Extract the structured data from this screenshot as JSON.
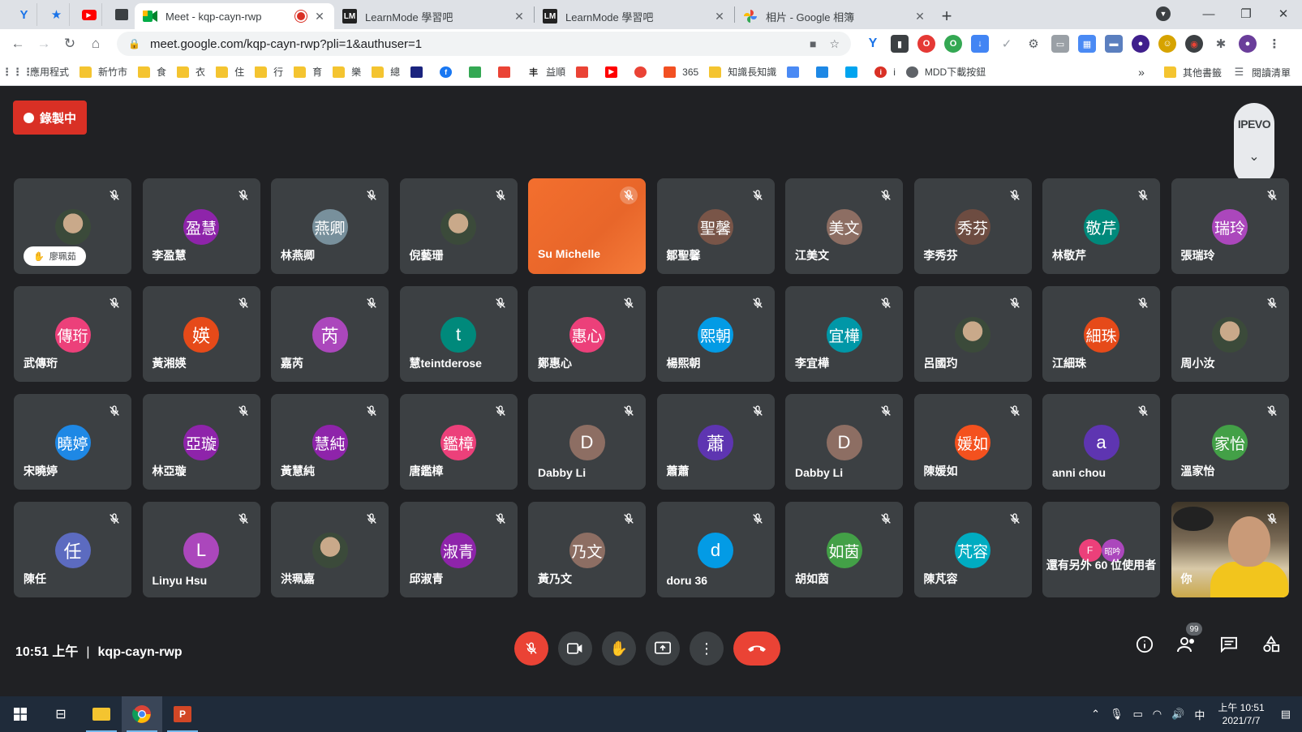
{
  "browser": {
    "tabs": [
      {
        "title": "Meet - kqp-cayn-rwp",
        "favicon": "meet-icon",
        "active": true,
        "recording": true
      },
      {
        "title": "LearnMode 學習吧",
        "favicon": "learnmode-icon",
        "active": false
      },
      {
        "title": "LearnMode 學習吧",
        "favicon": "learnmode-icon",
        "active": false
      },
      {
        "title": "相片 - Google 相簿",
        "favicon": "google-photos-icon",
        "active": false
      }
    ],
    "url": "meet.google.com/kqp-cayn-rwp?pli=1&authuser=1",
    "bookmarks": [
      {
        "label": "應用程式",
        "icon": "apps-grid-icon"
      },
      {
        "label": "新竹市",
        "icon": "folder-icon"
      },
      {
        "label": "食",
        "icon": "folder-icon"
      },
      {
        "label": "衣",
        "icon": "folder-icon"
      },
      {
        "label": "住",
        "icon": "folder-icon"
      },
      {
        "label": "行",
        "icon": "folder-icon"
      },
      {
        "label": "育",
        "icon": "folder-icon"
      },
      {
        "label": "樂",
        "icon": "folder-icon"
      },
      {
        "label": "總",
        "icon": "folder-icon"
      },
      {
        "label": "",
        "icon": "qr-icon"
      },
      {
        "label": "",
        "icon": "facebook-icon"
      },
      {
        "label": "",
        "icon": "google-drive-icon"
      },
      {
        "label": "",
        "icon": "pinwheel-icon"
      },
      {
        "label": "益順",
        "icon": "yi-icon"
      },
      {
        "label": "",
        "icon": "gmail-icon"
      },
      {
        "label": "",
        "icon": "youtube-icon"
      },
      {
        "label": "",
        "icon": "refresh-red-icon"
      },
      {
        "label": "365",
        "icon": "office-icon"
      },
      {
        "label": "知識長知識",
        "icon": "folder-icon"
      },
      {
        "label": "",
        "icon": "translate-icon"
      },
      {
        "label": "",
        "icon": "blue-app-icon"
      },
      {
        "label": "",
        "icon": "windows-icon"
      },
      {
        "label": "i",
        "icon": "info-red-icon"
      },
      {
        "label": "MDD下載按鈕",
        "icon": "globe-icon"
      }
    ],
    "bookmarks_more": "»",
    "other_bookmarks": "其他書籤",
    "reading_list": "閱讀清單"
  },
  "meet": {
    "recording_label": "錄製中",
    "ipevo_label": "IPEVO",
    "participants": [
      {
        "name": "廖珮茹",
        "initials": "",
        "color": "",
        "photo": true,
        "hand_pill": true
      },
      {
        "name": "李盈慧",
        "initials": "盈慧",
        "color": "#8e24aa"
      },
      {
        "name": "林燕卿",
        "initials": "燕卿",
        "color": "#78909c"
      },
      {
        "name": "倪藝珊",
        "initials": "",
        "color": "",
        "photo": true
      },
      {
        "name": "Su Michelle",
        "initials": "",
        "color": "",
        "speaking": true
      },
      {
        "name": "鄒聖馨",
        "initials": "聖馨",
        "color": "#795548"
      },
      {
        "name": "江美文",
        "initials": "美文",
        "color": "#8d6e63"
      },
      {
        "name": "李秀芬",
        "initials": "秀芬",
        "color": "#6d4c41"
      },
      {
        "name": "林敬芹",
        "initials": "敬芹",
        "color": "#00897b"
      },
      {
        "name": "張瑞玲",
        "initials": "瑞玲",
        "color": "#ab47bc"
      },
      {
        "name": "武傳珩",
        "initials": "傳珩",
        "color": "#ec407a"
      },
      {
        "name": "黃湘媖",
        "initials": "媖",
        "color": "#e64a19"
      },
      {
        "name": "嘉芮",
        "initials": "芮",
        "color": "#ab47bc"
      },
      {
        "name": "慧teintderose",
        "initials": "t",
        "color": "#00897b"
      },
      {
        "name": "鄭惠心",
        "initials": "惠心",
        "color": "#ec407a"
      },
      {
        "name": "楊熙朝",
        "initials": "熙朝",
        "color": "#039be5"
      },
      {
        "name": "李宜樺",
        "initials": "宜樺",
        "color": "#0097a7"
      },
      {
        "name": "呂國玓",
        "initials": "",
        "color": "",
        "photo": true
      },
      {
        "name": "江細珠",
        "initials": "細珠",
        "color": "#e64a19"
      },
      {
        "name": "周小汝",
        "initials": "",
        "color": "",
        "photo": true
      },
      {
        "name": "宋曉婷",
        "initials": "曉婷",
        "color": "#1e88e5"
      },
      {
        "name": "林亞璇",
        "initials": "亞璇",
        "color": "#8e24aa"
      },
      {
        "name": "黃慧純",
        "initials": "慧純",
        "color": "#8e24aa"
      },
      {
        "name": "唐鑑樟",
        "initials": "鑑樟",
        "color": "#ec407a"
      },
      {
        "name": "Dabby Li",
        "initials": "D",
        "color": "#8d6e63"
      },
      {
        "name": "蕭蕭",
        "initials": "蕭",
        "color": "#5e35b1"
      },
      {
        "name": "Dabby Li",
        "initials": "D",
        "color": "#8d6e63"
      },
      {
        "name": "陳媛如",
        "initials": "媛如",
        "color": "#f4511e"
      },
      {
        "name": "anni chou",
        "initials": "a",
        "color": "#5e35b1"
      },
      {
        "name": "溫家怡",
        "initials": "家怡",
        "color": "#43a047"
      },
      {
        "name": "陳任",
        "initials": "任",
        "color": "#5c6bc0"
      },
      {
        "name": "Linyu Hsu",
        "initials": "L",
        "color": "#ab47bc"
      },
      {
        "name": "洪珮嘉",
        "initials": "",
        "color": "",
        "photo": true
      },
      {
        "name": "邱淑青",
        "initials": "淑青",
        "color": "#8e24aa"
      },
      {
        "name": "黃乃文",
        "initials": "乃文",
        "color": "#8d6e63"
      },
      {
        "name": "doru 36",
        "initials": "d",
        "color": "#039be5"
      },
      {
        "name": "胡如茵",
        "initials": "如茵",
        "color": "#43a047"
      },
      {
        "name": "陳芃容",
        "initials": "芃容",
        "color": "#00acc1"
      }
    ],
    "others_tile": {
      "text": "還有另外 60 位使用者",
      "mini_avatars": [
        {
          "initials": "F",
          "color": "#ec407a"
        },
        {
          "initials": "昭吟",
          "color": "#ab47bc"
        }
      ]
    },
    "self_tile": {
      "name": "你"
    },
    "time": "10:51 上午",
    "meeting_code": "kqp-cayn-rwp",
    "participants_count": "99"
  },
  "taskbar": {
    "ime": "中",
    "time": "上午 10:51",
    "date": "2021/7/7"
  }
}
